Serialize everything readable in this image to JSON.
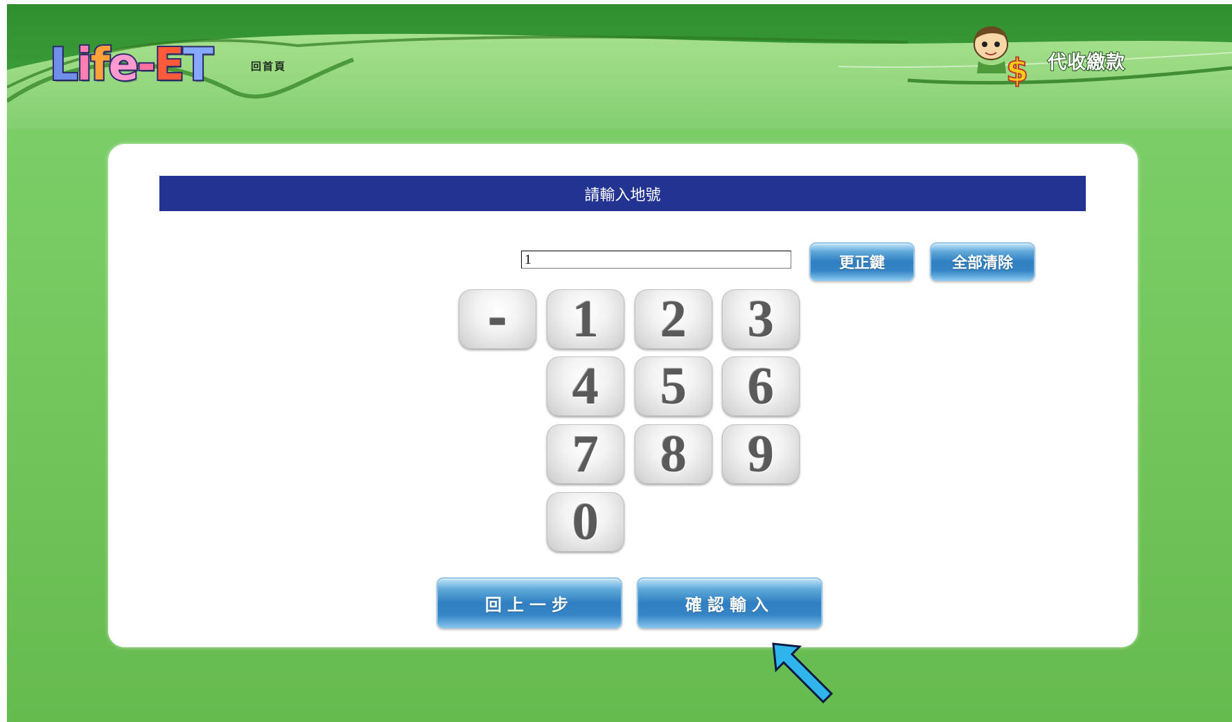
{
  "header": {
    "logo_text": "Life-ET",
    "home_link": "回首頁",
    "service_title": "代收繳款"
  },
  "panel": {
    "prompt": "請輸入地號",
    "input": {
      "value": "1"
    },
    "correct_button": "更正鍵",
    "clear_all_button": "全部清除",
    "keypad": {
      "dash": "-",
      "keys": [
        "1",
        "2",
        "3",
        "4",
        "5",
        "6",
        "7",
        "8",
        "9",
        "0"
      ]
    },
    "back_button": "回上一步",
    "confirm_button": "確認輸入"
  },
  "colors": {
    "background_green": "#78cc63",
    "prompt_bar": "#223391",
    "button_blue": "#2f7fc2",
    "arrow": "#2fb5ec"
  },
  "icons": {
    "mascot": "mascot-dollar-icon",
    "arrow": "pointer-arrow-icon"
  }
}
